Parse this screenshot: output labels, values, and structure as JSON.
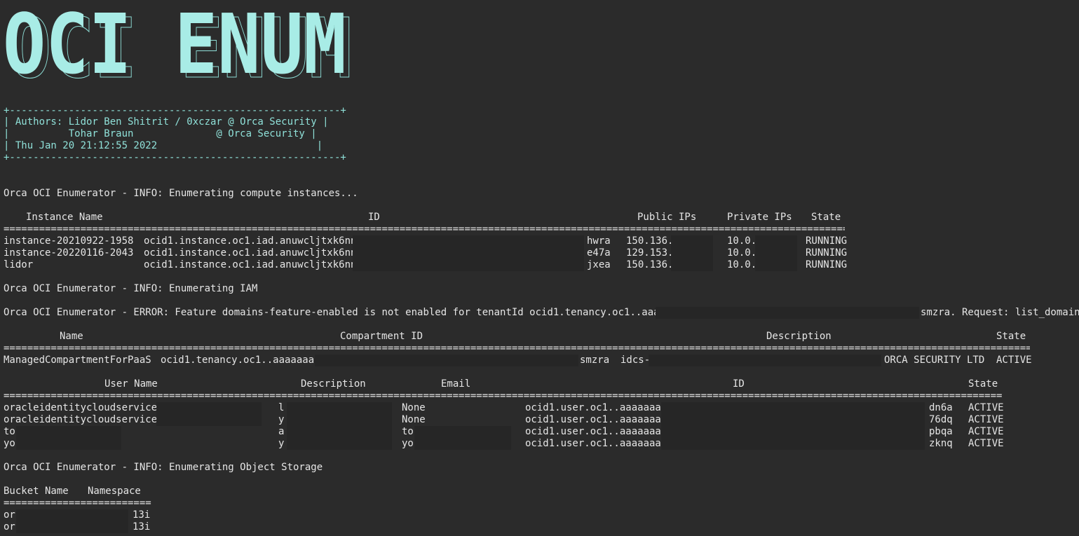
{
  "banner": {
    "text": "OCI ENUM"
  },
  "authors_box": {
    "border": "+--------------------------------------------------------+",
    "line1": "| Authors: Lidor Ben Shitrit / 0xczar @ Orca Security |",
    "line2": "|          Tohar Braun              @ Orca Security |",
    "line3": "| Thu Jan 20 21:12:55 2022                           |"
  },
  "info_compute": "Orca OCI Enumerator - INFO: Enumerating compute instances...",
  "instances": {
    "headers": {
      "name": "Instance Name",
      "id": "ID",
      "public": "Public IPs",
      "private": "Private IPs",
      "state": "State"
    },
    "rule": "=========================================================================================================================================================",
    "rows": [
      {
        "name": "instance-20210922-1958",
        "id": "ocid1.instance.oc1.iad.anuwcljtxk6nno",
        "id_end": "hwra",
        "public": "150.136.",
        "private": "10.0.",
        "state": "RUNNING"
      },
      {
        "name": "instance-20220116-2043",
        "id": "ocid1.instance.oc1.iad.anuwcljtxk6nno",
        "id_end": "e47a",
        "public": "129.153.",
        "private": "10.0.",
        "state": "RUNNING"
      },
      {
        "name": "lidor",
        "id": "ocid1.instance.oc1.iad.anuwcljtxk6nno",
        "id_end": "jxea",
        "public": "150.136.",
        "private": "10.0.",
        "state": "RUNNING"
      }
    ]
  },
  "info_iam": "Orca OCI Enumerator - INFO: Enumerating IAM",
  "error_line": {
    "start": "Orca OCI Enumerator - ERROR: Feature domains-feature-enabled is not enabled for tenantId ocid1.tenancy.oc1..aaaaaaaa",
    "end": "smzra. Request: list_domains"
  },
  "compartments": {
    "headers": {
      "name": "Name",
      "cid": "Compartment ID",
      "desc": "Description",
      "state": "State"
    },
    "rule": "===========================================================================================================================================================================================",
    "row": {
      "name": "ManagedCompartmentForPaaS",
      "cid": "ocid1.tenancy.oc1..aaaaaaaa",
      "cid_end": "smzra",
      "desc": "idcs-",
      "desc_end": "ORCA SECURITY LTD",
      "state": "ACTIVE"
    }
  },
  "users": {
    "headers": {
      "name": "User Name",
      "desc": "Description",
      "email": "Email",
      "id": "ID",
      "state": "State"
    },
    "rule": "===========================================================================================================================================================================================",
    "rows": [
      {
        "name": "oracleidentitycloudservice/",
        "desc": "l",
        "email": "None",
        "id": "ocid1.user.oc1..aaaaaaaa",
        "id_end": "dn6a",
        "state": "ACTIVE"
      },
      {
        "name": "oracleidentitycloudservice/",
        "desc": "y",
        "email": "None",
        "id": "ocid1.user.oc1..aaaaaaaa",
        "id_end": "76dq",
        "state": "ACTIVE"
      },
      {
        "name": "to",
        "desc": "a",
        "email": "to",
        "id": "ocid1.user.oc1..aaaaaaaa",
        "id_end": "pbqa",
        "state": "ACTIVE"
      },
      {
        "name": "yo",
        "desc": "y",
        "email": "yo",
        "id": "ocid1.user.oc1..aaaaaaaa",
        "id_end": "zknq",
        "state": "ACTIVE"
      }
    ]
  },
  "info_storage": "Orca OCI Enumerator - INFO: Enumerating Object Storage",
  "buckets": {
    "headers": {
      "name": "Bucket Name",
      "ns": "Namespace"
    },
    "rule": "=========================",
    "rows": [
      {
        "name": "or",
        "ns": "13i"
      },
      {
        "name": "or",
        "ns": "13i"
      }
    ]
  }
}
